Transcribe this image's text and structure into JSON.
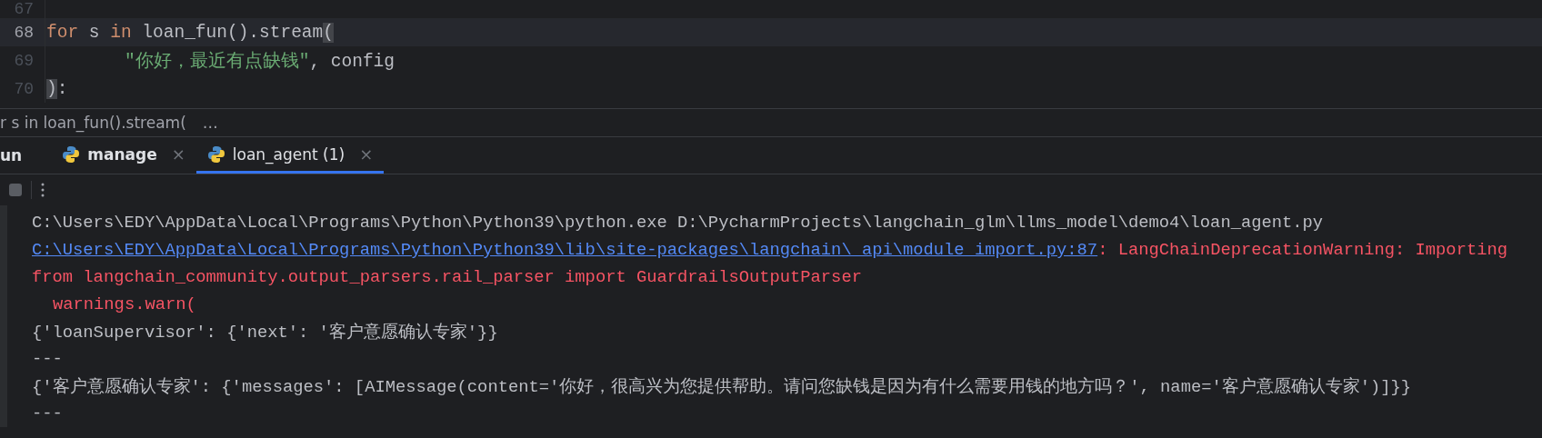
{
  "editor": {
    "lines": [
      {
        "number": "67",
        "current": false
      },
      {
        "number": "68",
        "current": true,
        "indent": false,
        "tokens": [
          {
            "kind": "keyword",
            "text": "for"
          },
          {
            "kind": "plain",
            "text": " s "
          },
          {
            "kind": "keyword",
            "text": "in"
          },
          {
            "kind": "plain",
            "text": " loan_fun().stream"
          },
          {
            "kind": "brace",
            "text": "("
          }
        ]
      },
      {
        "number": "69",
        "current": false,
        "indent": true,
        "tokens": [
          {
            "kind": "string",
            "text": "\"你好，最近有点缺钱\""
          },
          {
            "kind": "punct",
            "text": ", "
          },
          {
            "kind": "plain",
            "text": "config"
          }
        ]
      },
      {
        "number": "70",
        "current": false,
        "indent": false,
        "tokens": [
          {
            "kind": "brace",
            "text": ")"
          },
          {
            "kind": "punct",
            "text": ":"
          }
        ]
      }
    ]
  },
  "breadcrumb": {
    "text": "r s in loan_fun().stream(",
    "more": "…"
  },
  "run_panel": {
    "title": "un",
    "tabs": [
      {
        "label": "manage",
        "selected": false,
        "close": "×"
      },
      {
        "label": "loan_agent (1)",
        "selected": true,
        "close": "×"
      }
    ],
    "console": [
      {
        "indent": false,
        "segments": [
          {
            "kind": "plain",
            "text": "C:\\Users\\EDY\\AppData\\Local\\Programs\\Python\\Python39\\python.exe D:\\PycharmProjects\\langchain_glm\\llms_model\\demo4\\loan_agent.py"
          }
        ]
      },
      {
        "indent": false,
        "segments": [
          {
            "kind": "link",
            "text": "C:\\Users\\EDY\\AppData\\Local\\Programs\\Python\\Python39\\lib\\site-packages\\langchain\\_api\\module_import.py:87"
          },
          {
            "kind": "error",
            "text": ": LangChainDeprecationWarning: Importing"
          }
        ]
      },
      {
        "indent": false,
        "segments": [
          {
            "kind": "error",
            "text": "from langchain_community.output_parsers.rail_parser import GuardrailsOutputParser"
          }
        ]
      },
      {
        "indent": true,
        "segments": [
          {
            "kind": "error",
            "text": "warnings.warn("
          }
        ]
      },
      {
        "indent": false,
        "segments": [
          {
            "kind": "plain",
            "text": "{'loanSupervisor': {'next': '客户意愿确认专家'}}"
          }
        ]
      },
      {
        "indent": false,
        "segments": [
          {
            "kind": "plain",
            "text": "---"
          }
        ]
      },
      {
        "indent": false,
        "segments": [
          {
            "kind": "plain",
            "text": "{'客户意愿确认专家': {'messages': [AIMessage(content='你好，很高兴为您提供帮助。请问您缺钱是因为有什么需要用钱的地方吗？', name='客户意愿确认专家')]}}"
          }
        ]
      },
      {
        "indent": false,
        "segments": [
          {
            "kind": "plain",
            "text": "---"
          }
        ]
      }
    ]
  }
}
